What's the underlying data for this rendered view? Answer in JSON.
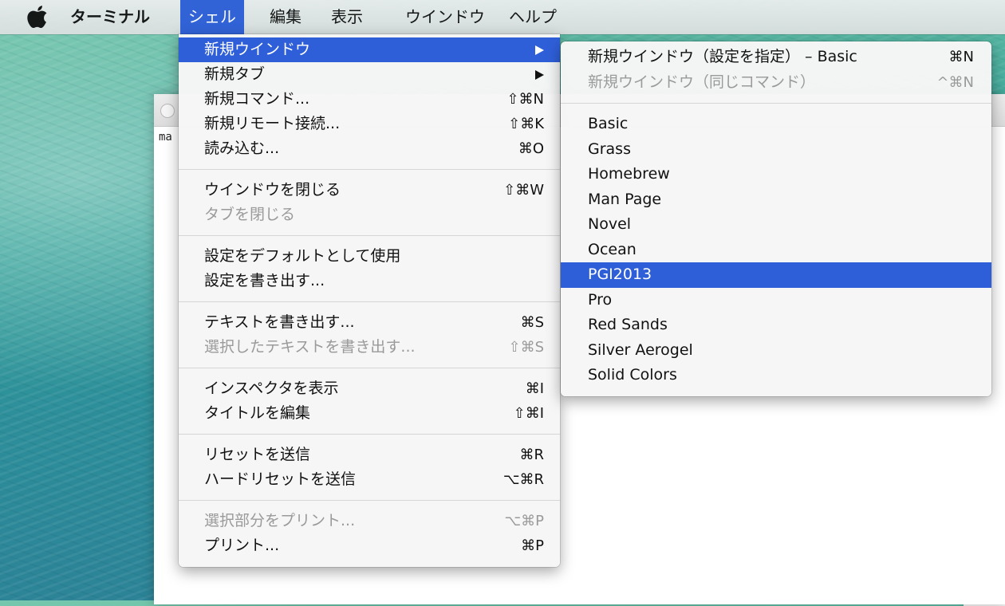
{
  "menubar": {
    "apple_icon": "apple-logo-icon",
    "items": [
      {
        "label": "ターミナル"
      },
      {
        "label": "シェル"
      },
      {
        "label": "編集"
      },
      {
        "label": "表示"
      },
      {
        "label": "ウインドウ"
      },
      {
        "label": "ヘルプ"
      }
    ]
  },
  "terminal": {
    "prompt_fragment": "ma"
  },
  "shell_menu": {
    "items": [
      {
        "label": "新規ウインドウ",
        "shortcut": "",
        "submenu": true,
        "state": "highlighted"
      },
      {
        "label": "新規タブ",
        "shortcut": "",
        "submenu": true
      },
      {
        "label": "新規コマンド...",
        "shortcut": "⇧⌘N"
      },
      {
        "label": "新規リモート接続...",
        "shortcut": "⇧⌘K"
      },
      {
        "label": "読み込む...",
        "shortcut": "⌘O"
      },
      {
        "label": "ウインドウを閉じる",
        "shortcut": "⇧⌘W"
      },
      {
        "label": "タブを閉じる",
        "shortcut": "",
        "state": "disabled"
      },
      {
        "label": "設定をデフォルトとして使用",
        "shortcut": ""
      },
      {
        "label": "設定を書き出す...",
        "shortcut": ""
      },
      {
        "label": "テキストを書き出す...",
        "shortcut": "⌘S"
      },
      {
        "label": "選択したテキストを書き出す...",
        "shortcut": "⇧⌘S",
        "state": "disabled"
      },
      {
        "label": "インスペクタを表示",
        "shortcut": "⌘I"
      },
      {
        "label": "タイトルを編集",
        "shortcut": "⇧⌘I"
      },
      {
        "label": "リセットを送信",
        "shortcut": "⌘R"
      },
      {
        "label": "ハードリセットを送信",
        "shortcut": "⌥⌘R"
      },
      {
        "label": "選択部分をプリント...",
        "shortcut": "⌥⌘P",
        "state": "disabled"
      },
      {
        "label": "プリント...",
        "shortcut": "⌘P"
      }
    ]
  },
  "new_window_submenu": {
    "items": [
      {
        "label": "新規ウインドウ（設定を指定） – Basic",
        "shortcut": "⌘N"
      },
      {
        "label": "新規ウインドウ（同じコマンド）",
        "shortcut": "^⌘N",
        "state": "disabled"
      },
      {
        "label": "Basic"
      },
      {
        "label": "Grass"
      },
      {
        "label": "Homebrew"
      },
      {
        "label": "Man Page"
      },
      {
        "label": "Novel"
      },
      {
        "label": "Ocean"
      },
      {
        "label": "PGI2013",
        "state": "highlighted"
      },
      {
        "label": "Pro"
      },
      {
        "label": "Red Sands"
      },
      {
        "label": "Silver Aerogel"
      },
      {
        "label": "Solid Colors"
      }
    ]
  },
  "colors": {
    "highlight": "#2f5fd8",
    "disabled_text": "#9a9a9a"
  }
}
